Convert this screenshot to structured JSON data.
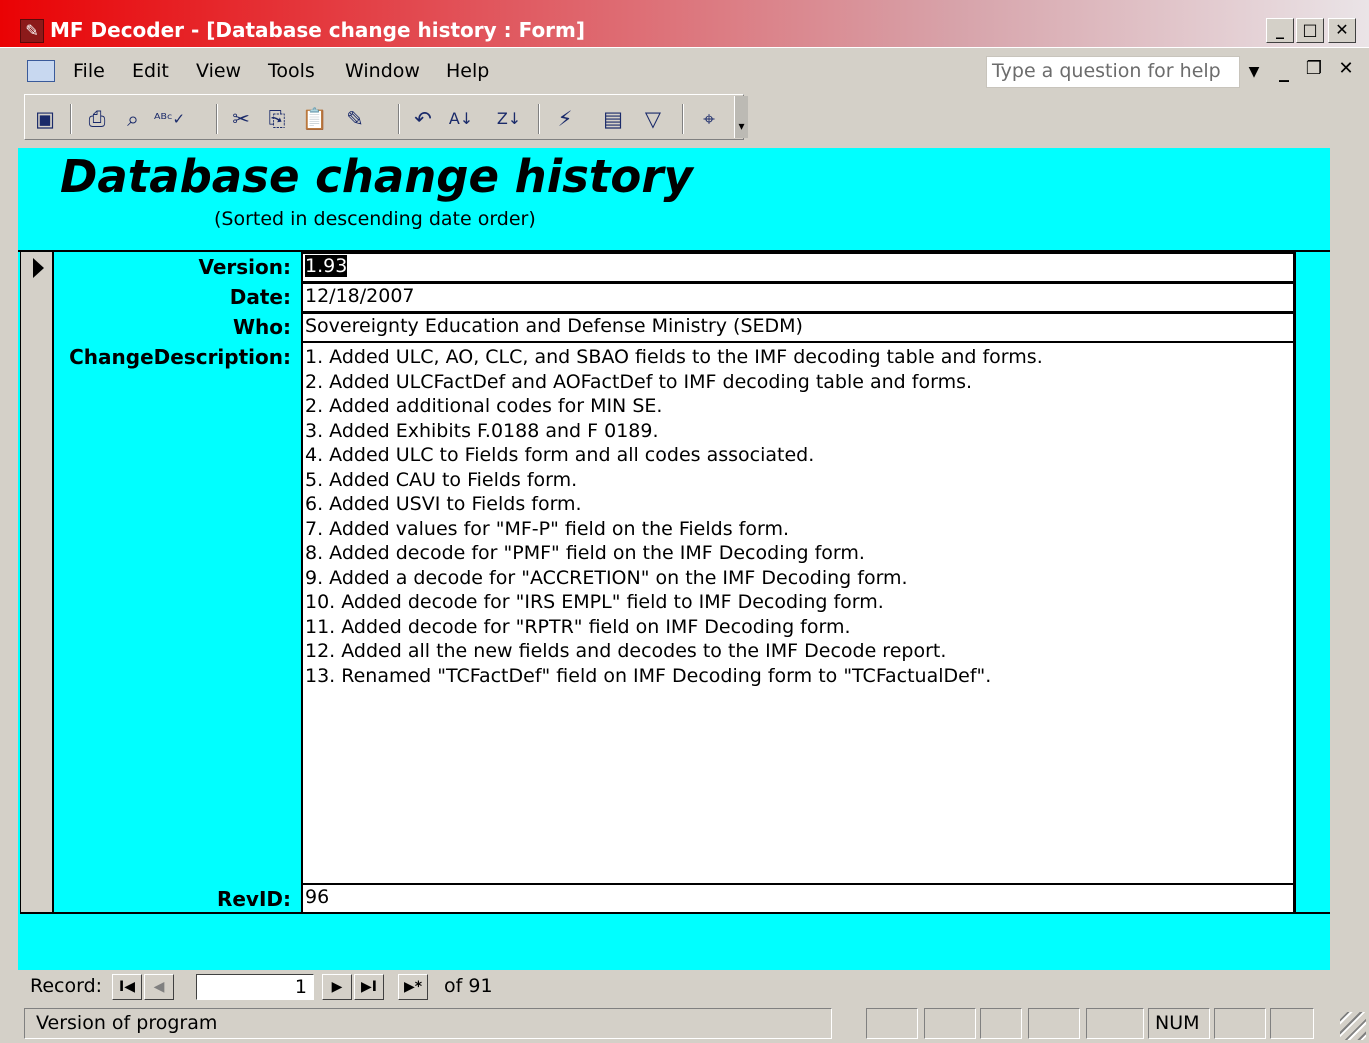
{
  "window": {
    "title": "MF Decoder - [Database change history : Form]",
    "minimize_glyph": "_",
    "restore_glyph": "❐",
    "close_glyph": "✕"
  },
  "menu": {
    "items": [
      "File",
      "Edit",
      "View",
      "Tools",
      "Window",
      "Help"
    ],
    "help_placeholder": "Type a question for help"
  },
  "toolbar": {
    "icons": [
      "save-icon",
      "print-icon",
      "print-preview-icon",
      "spelling-icon",
      "cut-icon",
      "copy-icon",
      "paste-icon",
      "format-painter-icon",
      "undo-icon",
      "sort-ascending-icon",
      "sort-descending-icon",
      "filter-by-selection-icon",
      "filter-by-form-icon",
      "apply-filter-icon",
      "find-icon"
    ]
  },
  "form": {
    "title": "Database change history",
    "subtitle": "(Sorted in descending date order)",
    "background": "#00ffff",
    "labels": {
      "version": "Version:",
      "date": "Date:",
      "who": "Who:",
      "change_description": "ChangeDescription:",
      "revid": "RevID:"
    },
    "record": {
      "version": "1.93",
      "date": "12/18/2007",
      "who": "Sovereignty Education and Defense Ministry (SEDM)",
      "change_description": [
        "1. Added ULC, AO, CLC, and SBAO fields to the IMF decoding table and forms.",
        "2.  Added ULCFactDef and AOFactDef to IMF decoding table and forms.",
        "2.  Added additional codes for MIN SE.",
        "3.  Added Exhibits F.0188 and F 0189.",
        "4.  Added ULC to Fields form and all codes associated.",
        "5.  Added CAU to Fields form.",
        "6.  Added USVI to Fields form.",
        "7.  Added values for \"MF-P\" field on the Fields form.",
        "8.  Added decode for \"PMF\" field on the IMF Decoding form.",
        "9.  Added a decode for \"ACCRETION\" on the IMF Decoding form.",
        "10.  Added decode for \"IRS EMPL\" field to IMF Decoding form.",
        "11.  Added decode for \"RPTR\" field on IMF Decoding form.",
        "12.  Added all the new fields and decodes to the IMF Decode report.",
        "13.  Renamed \"TCFactDef\" field on IMF Decoding form to \"TCFactualDef\"."
      ],
      "revid": "96"
    }
  },
  "navigator": {
    "label": "Record:",
    "current": "1",
    "of_text": "of  91",
    "first": "I◀",
    "prev": "◀",
    "next": "▶",
    "last": "▶I",
    "new": "▶*"
  },
  "status": {
    "text": "Version of program",
    "num": "NUM"
  }
}
